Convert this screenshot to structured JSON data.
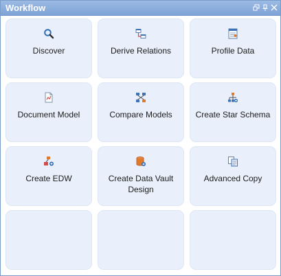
{
  "panel": {
    "title": "Workflow",
    "controls": [
      "restore-icon",
      "pin-icon",
      "close-icon"
    ]
  },
  "tiles": [
    {
      "label": "Discover",
      "icon": "search-icon"
    },
    {
      "label": "Derive Relations",
      "icon": "relations-icon"
    },
    {
      "label": "Profile Data",
      "icon": "profile-icon"
    },
    {
      "label": "Document Model",
      "icon": "document-icon"
    },
    {
      "label": "Compare Models",
      "icon": "compare-icon"
    },
    {
      "label": "Create Star Schema",
      "icon": "star-schema-icon"
    },
    {
      "label": "Create EDW",
      "icon": "edw-icon"
    },
    {
      "label": "Create Data Vault Design",
      "icon": "data-vault-icon"
    },
    {
      "label": "Advanced Copy",
      "icon": "copy-icon"
    }
  ],
  "colors": {
    "titlebar": "#8cb0de",
    "tile_bg": "#e9f0fb",
    "accent_blue": "#2e6db5",
    "accent_orange": "#e07a2a"
  }
}
